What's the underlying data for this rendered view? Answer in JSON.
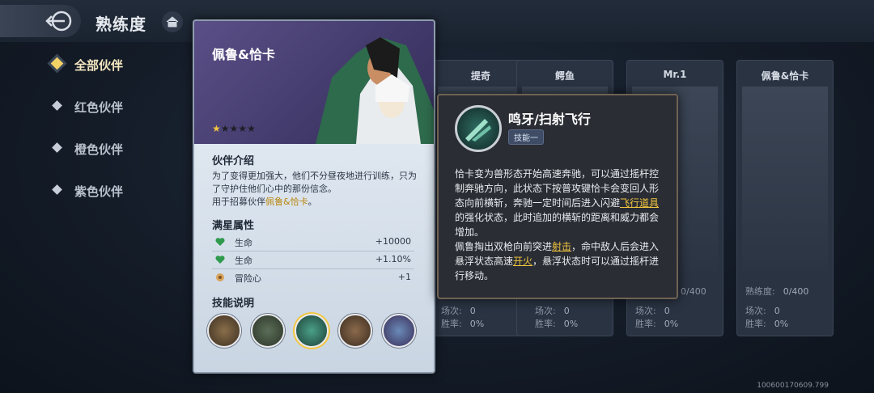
{
  "header": {
    "title": "熟练度"
  },
  "sidebar": {
    "items": [
      {
        "label": "全部伙伴",
        "active": true
      },
      {
        "label": "红色伙伴",
        "active": false
      },
      {
        "label": "橙色伙伴",
        "active": false
      },
      {
        "label": "紫色伙伴",
        "active": false
      }
    ]
  },
  "bg_cards": [
    {
      "name": "提奇",
      "prof_label": "",
      "prof_value": "",
      "battles_label": "场次:",
      "battles": "0",
      "winrate_label": "胜率:",
      "winrate": "0%"
    },
    {
      "name": "鳄鱼",
      "prof_label": "",
      "prof_value": "",
      "battles_label": "场次:",
      "battles": "0",
      "winrate_label": "胜率:",
      "winrate": "0%"
    },
    {
      "name": "Mr.1",
      "prof_label": "",
      "prof_value": "0/400",
      "battles_label": "场次:",
      "battles": "0",
      "winrate_label": "胜率:",
      "winrate": "0%"
    },
    {
      "name": "佩鲁&恰卡",
      "prof_label": "熟练度:",
      "prof_value": "0/400",
      "battles_label": "场次:",
      "battles": "0",
      "winrate_label": "胜率:",
      "winrate": "0%"
    }
  ],
  "detail": {
    "name": "佩鲁&恰卡",
    "stars_total": 5,
    "stars_filled": 1,
    "intro_title": "伙伴介绍",
    "intro_text": "为了变得更加强大，他们不分昼夜地进行训练，只为了守护住他们心中的那份信念。",
    "intro_recruit_prefix": "用于招募伙伴",
    "intro_recruit_name": "佩鲁&恰卡",
    "intro_recruit_suffix": "。",
    "attr_title": "满星属性",
    "attrs": [
      {
        "name": "生命",
        "value": "+10000",
        "icon": "heart-icon"
      },
      {
        "name": "生命",
        "value": "+1.10%",
        "icon": "heart-icon"
      },
      {
        "name": "冒险心",
        "value": "+1",
        "icon": "compass-icon"
      }
    ],
    "skill_title": "技能说明"
  },
  "popup": {
    "skill_name": "鸣牙/扫射飞行",
    "tag": "技能一",
    "desc_1": "恰卡变为兽形态开始高速奔驰，可以通过摇杆控制奔驰方向，此状态下按普攻键恰卡会变回人形态向前横斩，奔驰一定时间后进入闪避",
    "kw_1": "飞行道具",
    "desc_2": "的强化状态，此时追加的横斩的距离和威力都会增加。",
    "desc_3": "佩鲁掏出双枪向前突进",
    "kw_2": "射击",
    "desc_4": "，命中敌人后会进入悬浮状态高速",
    "kw_3": "开火",
    "desc_5": "，悬浮状态时可以通过摇杆进行移动。"
  },
  "version": "100600170609.799",
  "colors": {
    "accent_gold": "#f2c640",
    "popup_bg": "#2a2d34",
    "card_bg": "#c7d2de"
  }
}
